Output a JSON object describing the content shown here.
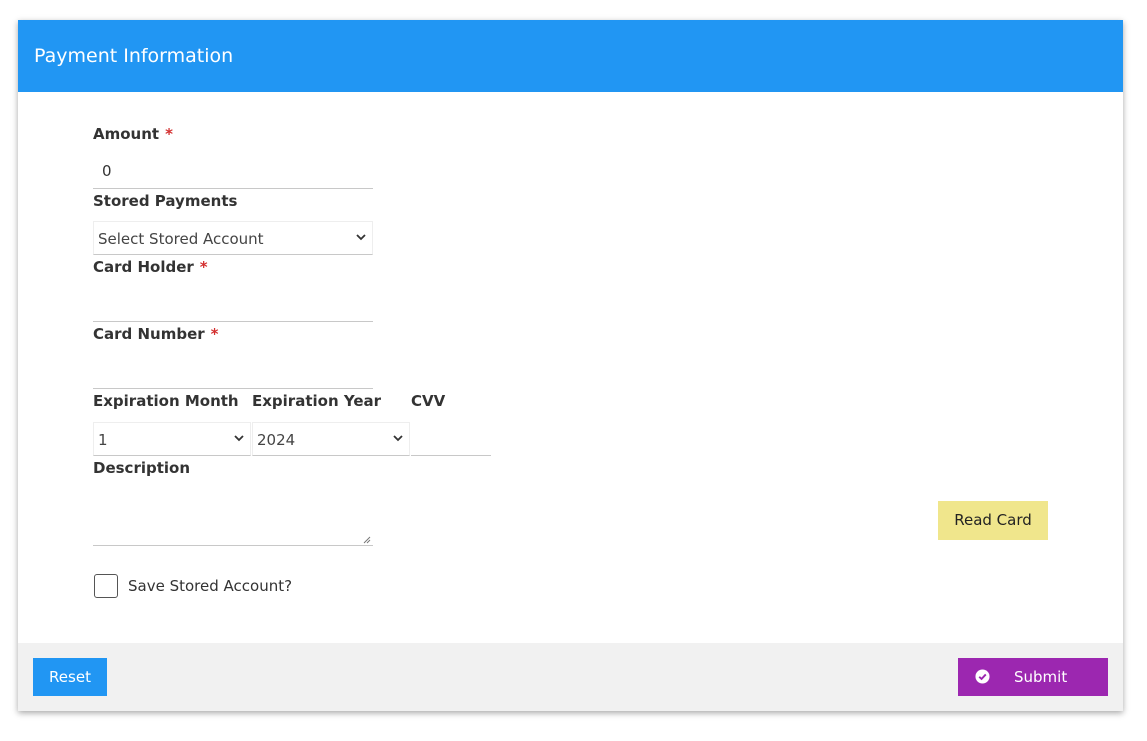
{
  "header": {
    "title": "Payment Information"
  },
  "form": {
    "amount": {
      "label": "Amount",
      "required_mark": "*",
      "value": "0"
    },
    "stored_payments": {
      "label": "Stored Payments",
      "selected": "Select Stored Account"
    },
    "card_holder": {
      "label": "Card Holder",
      "required_mark": "*",
      "value": ""
    },
    "card_number": {
      "label": "Card Number",
      "required_mark": "*",
      "value": ""
    },
    "expiration_month": {
      "label": "Expiration Month",
      "selected": "1"
    },
    "expiration_year": {
      "label": "Expiration Year",
      "selected": "2024"
    },
    "cvv": {
      "label": "CVV",
      "value": ""
    },
    "description": {
      "label": "Description",
      "value": ""
    },
    "save_stored_account": {
      "label": "Save Stored Account?",
      "checked": false
    }
  },
  "buttons": {
    "read_card": "Read Card",
    "reset": "Reset",
    "submit": "Submit"
  },
  "icons": {
    "dropdown": "chevron-down-icon",
    "submit": "check-circle-icon"
  },
  "colors": {
    "header": "#2196f3",
    "reset": "#2196f3",
    "submit": "#9c27b0",
    "read_card": "#f0e68c",
    "required": "#d32f2f",
    "footer": "#f1f1f1"
  }
}
